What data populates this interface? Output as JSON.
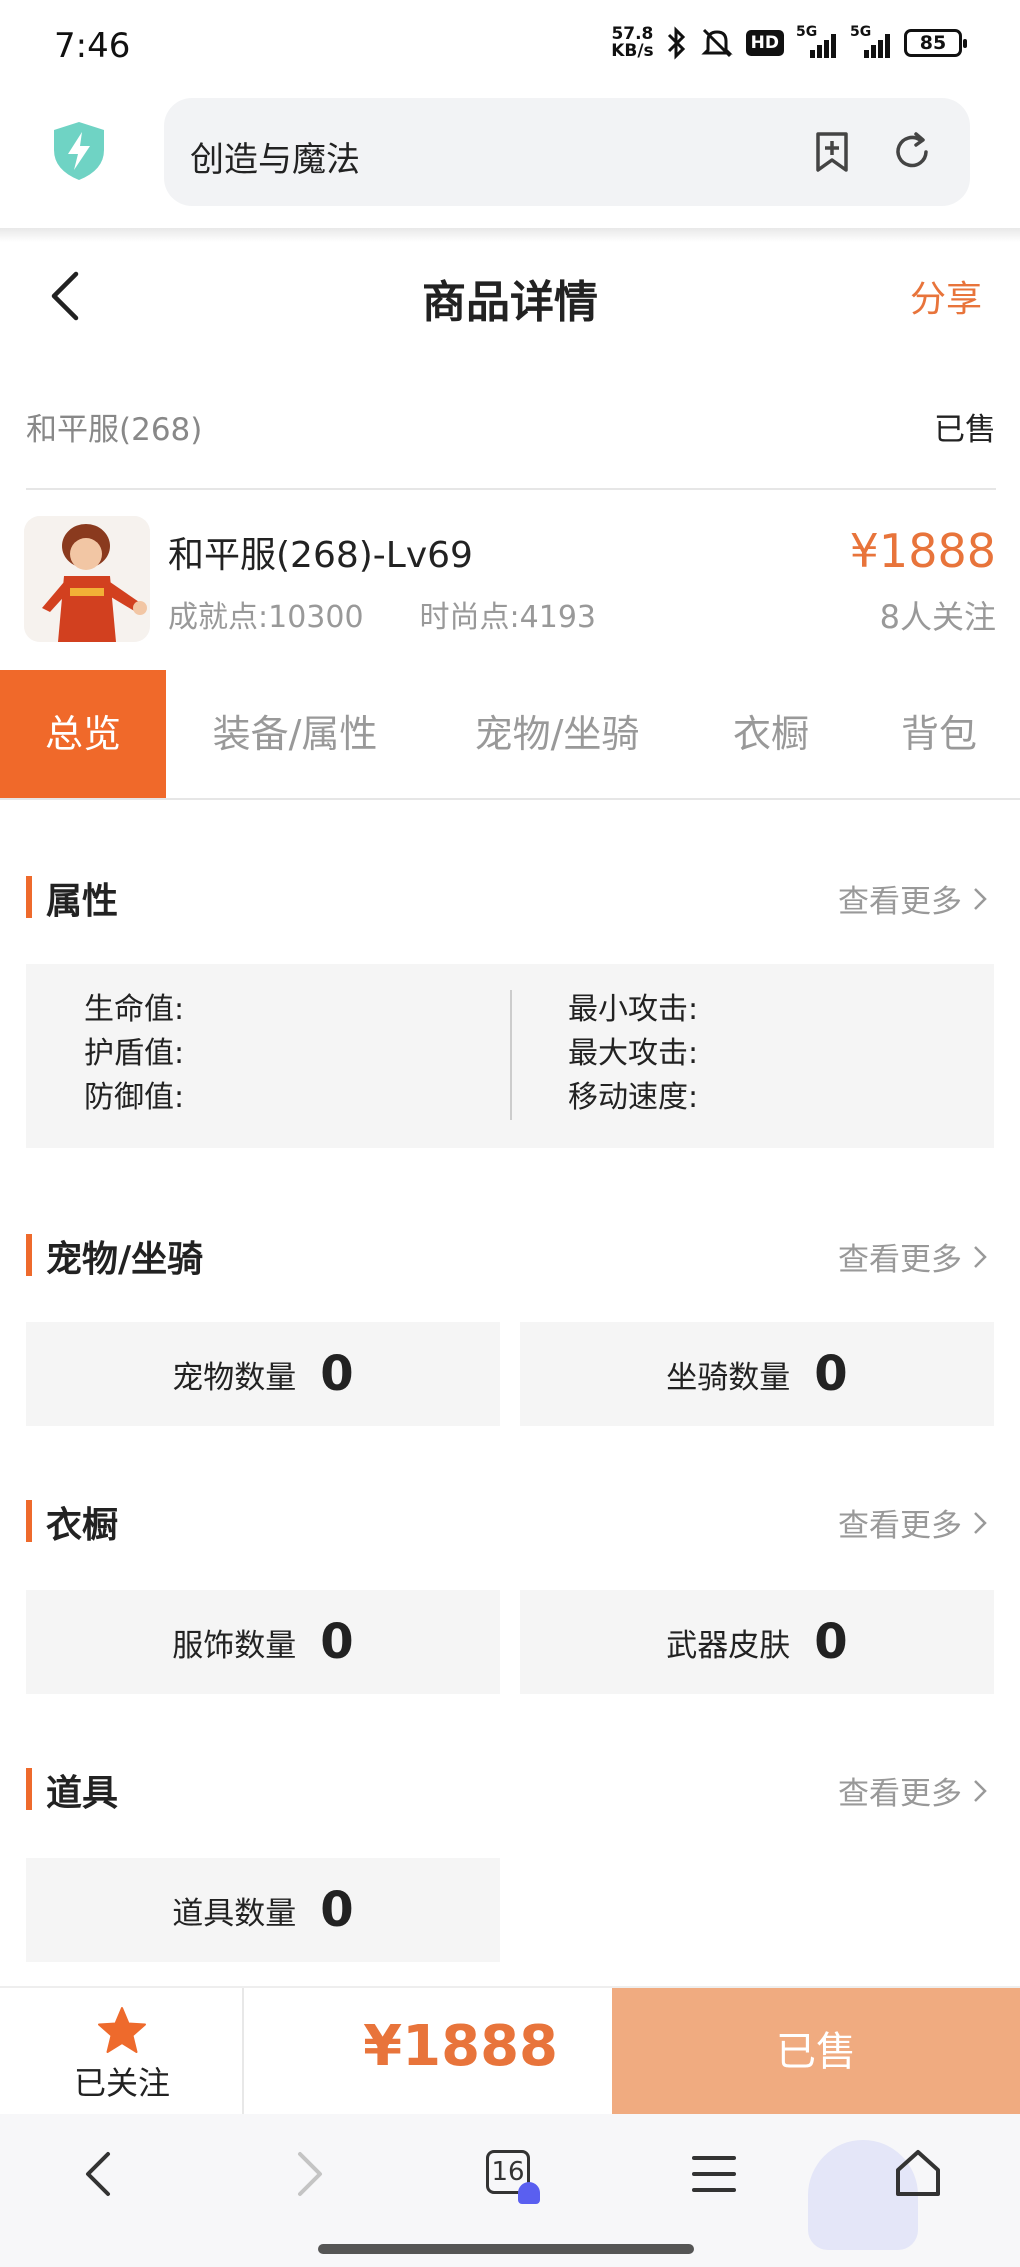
{
  "status_bar": {
    "time": "7:46",
    "net_speed_value": "57.8",
    "net_speed_unit": "KB/s",
    "hd_label": "HD",
    "signal1_label": "5G",
    "signal2_label": "5G",
    "battery": "85",
    "icons": [
      "bluetooth-icon",
      "bell-off-icon",
      "signal-icon",
      "battery-icon"
    ]
  },
  "browser": {
    "address_text": "创造与魔法",
    "icons": [
      "shield-bolt-icon",
      "bookmark-add-icon",
      "refresh-icon"
    ]
  },
  "header": {
    "title": "商品详情",
    "share": "分享"
  },
  "server": {
    "name": "和平服(268)",
    "status": "已售"
  },
  "product": {
    "name": "和平服(268)-Lv69",
    "achievement": "成就点:10300",
    "fashion": "时尚点:4193",
    "price": "¥1888",
    "followers": "8人关注"
  },
  "tabs": [
    {
      "label": "总览",
      "active": true
    },
    {
      "label": "装备/属性",
      "active": false
    },
    {
      "label": "宠物/坐骑",
      "active": false
    },
    {
      "label": "衣橱",
      "active": false
    },
    {
      "label": "背包",
      "active": false
    }
  ],
  "see_more": "查看更多",
  "sections": {
    "attributes": {
      "title": "属性",
      "left": [
        "生命值:",
        "护盾值:",
        "防御值:"
      ],
      "right": [
        "最小攻击:",
        "最大攻击:",
        "移动速度:"
      ]
    },
    "pets": {
      "title": "宠物/坐骑",
      "stats": [
        {
          "label": "宠物数量",
          "value": "0"
        },
        {
          "label": "坐骑数量",
          "value": "0"
        }
      ]
    },
    "wardrobe": {
      "title": "衣橱",
      "stats": [
        {
          "label": "服饰数量",
          "value": "0"
        },
        {
          "label": "武器皮肤",
          "value": "0"
        }
      ]
    },
    "items": {
      "title": "道具",
      "stats": [
        {
          "label": "道具数量",
          "value": "0"
        }
      ]
    }
  },
  "action_bar": {
    "followed": "已关注",
    "price": "¥1888",
    "sold_button": "已售"
  },
  "browser_nav": {
    "tab_count": "16"
  },
  "colors": {
    "accent": "#f0692a",
    "price": "#e8743b",
    "sold_button_bg": "#f0ab80",
    "panel_bg": "#f5f5f5"
  }
}
